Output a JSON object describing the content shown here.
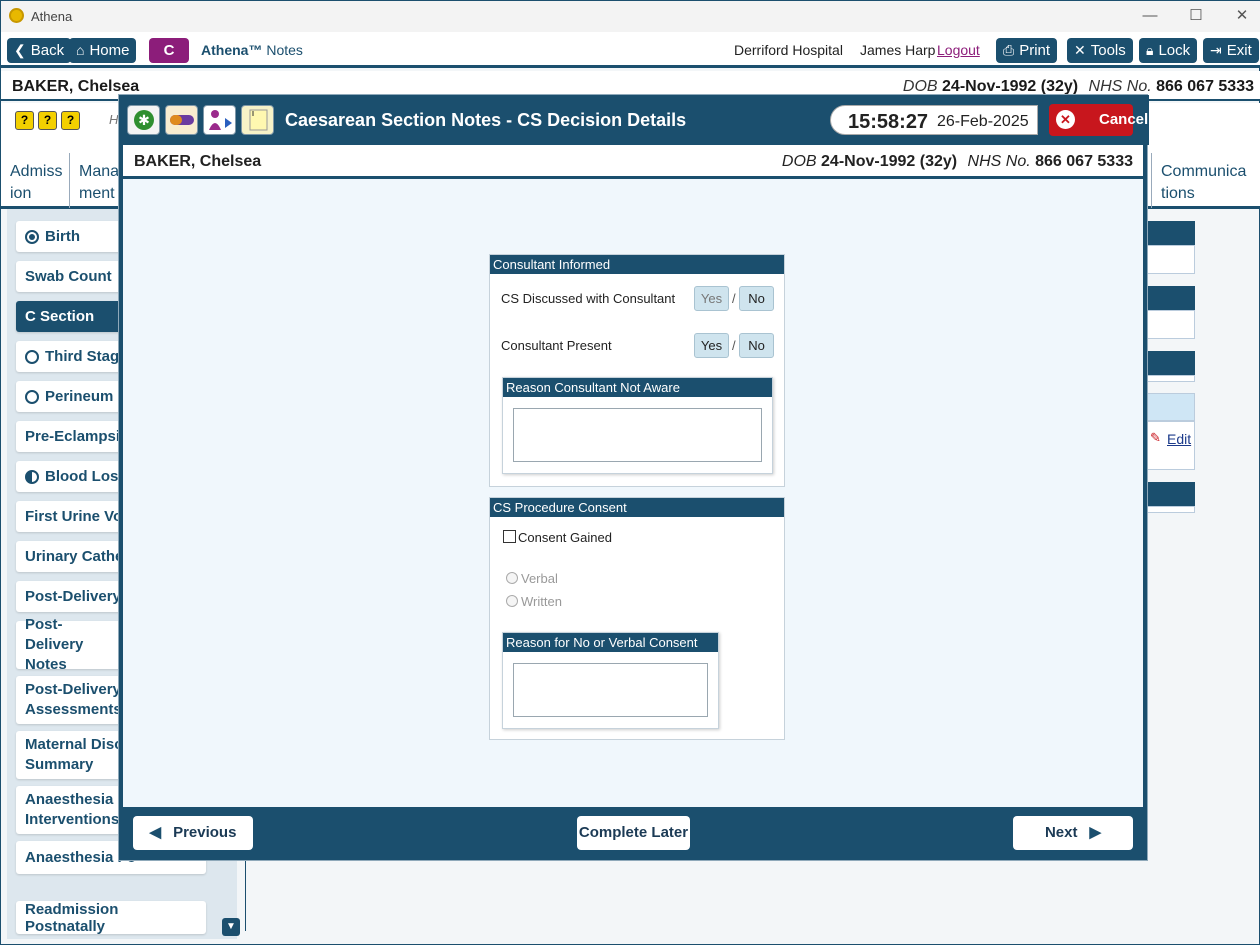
{
  "app": {
    "title": "Athena"
  },
  "window_controls": {
    "minimize": "—",
    "maximize": "☐",
    "close": "✕"
  },
  "toolbar": {
    "back": "Back",
    "home": "Home",
    "c_badge": "C",
    "app_name": "Athena™",
    "app_section": "Notes",
    "hospital": "Derriford Hospital",
    "user": "James Harp",
    "logout": "Logout",
    "print": "Print",
    "tools": "Tools",
    "lock": "Lock",
    "exit": "Exit"
  },
  "patient": {
    "name": "BAKER, Chelsea",
    "dob_label": "DOB",
    "dob": "24-Nov-1992 (32y)",
    "nhs_label": "NHS No.",
    "nhs": "866 067 5333"
  },
  "hint_text": "H",
  "tabs": [
    {
      "label": "Admiss ion"
    },
    {
      "label": "Mana ment"
    },
    {
      "label": "Communica tions"
    }
  ],
  "sidebar": {
    "items": [
      {
        "label": "Birth",
        "status": "full"
      },
      {
        "label": "Swab Count",
        "status": "none"
      },
      {
        "label": "C Section",
        "status": "active"
      },
      {
        "label": "Third Stage",
        "status": "empty"
      },
      {
        "label": "Perineum",
        "status": "empty"
      },
      {
        "label": "Pre-Eclampsia",
        "status": "none"
      },
      {
        "label": "Blood Loss",
        "status": "half"
      },
      {
        "label": "First Urine Voi",
        "status": "none"
      },
      {
        "label": "Urinary Cathe",
        "status": "none"
      },
      {
        "label": "Post-Delivery",
        "status": "none"
      },
      {
        "label": "Post-Delivery Notes",
        "status": "none"
      },
      {
        "label": "Post-Delivery Assessments",
        "status": "none"
      },
      {
        "label": "Maternal Disc Summary",
        "status": "none"
      },
      {
        "label": "Anaesthesia Interventions",
        "status": "none"
      },
      {
        "label": "Anaesthesia Fo",
        "status": "none"
      },
      {
        "label": "Readmission Postnatally",
        "status": "none"
      }
    ]
  },
  "right_panel": {
    "edit": "Edit"
  },
  "modal": {
    "title": "Caesarean Section Notes - CS Decision Details",
    "time": "15:58:27",
    "date": "26-Feb-2025",
    "cancel": "Cancel",
    "consultant_informed": {
      "header": "Consultant Informed",
      "discussed_label": "CS Discussed with Consultant",
      "present_label": "Consultant Present",
      "yes": "Yes",
      "no": "No",
      "sep": "/",
      "reason_header": "Reason Consultant Not Aware",
      "reason_value": ""
    },
    "consent": {
      "header": "CS Procedure Consent",
      "gained_label": "Consent Gained",
      "gained_checked": false,
      "verbal": "Verbal",
      "written": "Written",
      "reason_header": "Reason for No or Verbal Consent",
      "reason_value": ""
    },
    "footer": {
      "previous": "Previous",
      "complete_later": "Complete Later",
      "next": "Next"
    }
  }
}
